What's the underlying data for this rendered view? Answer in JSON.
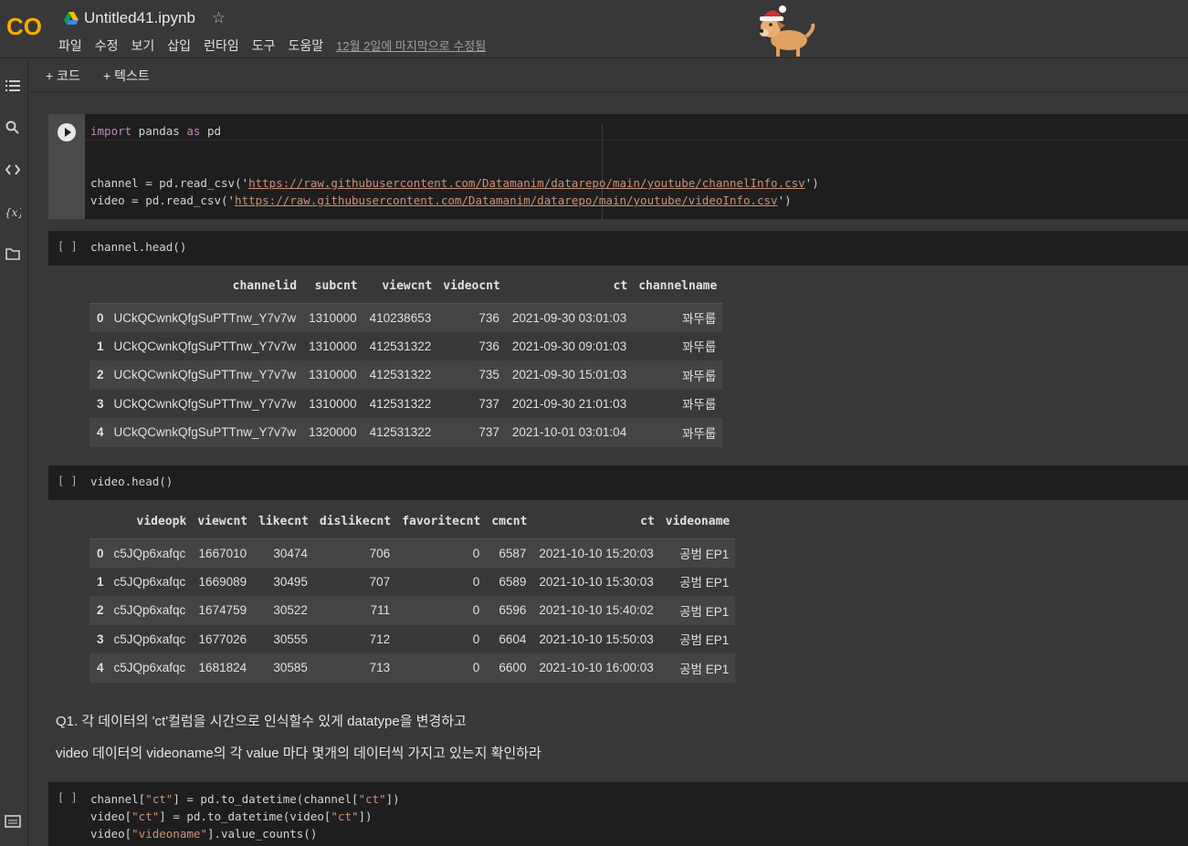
{
  "header": {
    "logo": "CO",
    "title": "Untitled41.ipynb",
    "menu": [
      "파일",
      "수정",
      "보기",
      "삽입",
      "런타임",
      "도구",
      "도움말"
    ],
    "last_edit": "12월 2일에 마지막으로 수정됨"
  },
  "toolbar": {
    "add_code": "+ 코드",
    "add_text": "+ 텍스트"
  },
  "cells": {
    "c1": {
      "line1_kw1": "import",
      "line1_mid": " pandas ",
      "line1_kw2": "as",
      "line1_end": " pd",
      "line2_pre": "channel = pd.read_csv('",
      "line2_url": "https://raw.githubusercontent.com/Datamanim/datarepo/main/youtube/channelInfo.csv",
      "line2_post": "')",
      "line3_pre": "video = pd.read_csv('",
      "line3_url": "https://raw.githubusercontent.com/Datamanim/datarepo/main/youtube/videoInfo.csv",
      "line3_post": "')"
    },
    "c2": {
      "bracket": "[ ]",
      "code": "channel.head()"
    },
    "c3": {
      "bracket": "[ ]",
      "code": "video.head()"
    },
    "c4": {
      "bracket": "[ ]",
      "l1_a": "channel[",
      "l1_s1": "\"ct\"",
      "l1_b": "] = pd.to_datetime(channel[",
      "l1_s2": "\"ct\"",
      "l1_c": "])",
      "l2_a": "video[",
      "l2_s1": "\"ct\"",
      "l2_b": "] = pd.to_datetime(video[",
      "l2_s2": "\"ct\"",
      "l2_c": "])",
      "l3_a": "video[",
      "l3_s1": "\"videoname\"",
      "l3_b": "].value_counts()"
    }
  },
  "channel_df": {
    "columns": [
      "",
      "channelid",
      "subcnt",
      "viewcnt",
      "videocnt",
      "ct",
      "channelname"
    ],
    "rows": [
      [
        "0",
        "UCkQCwnkQfgSuPTTnw_Y7v7w",
        "1310000",
        "410238653",
        "736",
        "2021-09-30 03:01:03",
        "꽈뚜룹"
      ],
      [
        "1",
        "UCkQCwnkQfgSuPTTnw_Y7v7w",
        "1310000",
        "412531322",
        "736",
        "2021-09-30 09:01:03",
        "꽈뚜룹"
      ],
      [
        "2",
        "UCkQCwnkQfgSuPTTnw_Y7v7w",
        "1310000",
        "412531322",
        "735",
        "2021-09-30 15:01:03",
        "꽈뚜룹"
      ],
      [
        "3",
        "UCkQCwnkQfgSuPTTnw_Y7v7w",
        "1310000",
        "412531322",
        "737",
        "2021-09-30 21:01:03",
        "꽈뚜룹"
      ],
      [
        "4",
        "UCkQCwnkQfgSuPTTnw_Y7v7w",
        "1320000",
        "412531322",
        "737",
        "2021-10-01 03:01:04",
        "꽈뚜룹"
      ]
    ]
  },
  "video_df": {
    "columns": [
      "",
      "videopk",
      "viewcnt",
      "likecnt",
      "dislikecnt",
      "favoritecnt",
      "cmcnt",
      "ct",
      "videoname"
    ],
    "rows": [
      [
        "0",
        "c5JQp6xafqc",
        "1667010",
        "30474",
        "706",
        "0",
        "6587",
        "2021-10-10 15:20:03",
        "공범 EP1"
      ],
      [
        "1",
        "c5JQp6xafqc",
        "1669089",
        "30495",
        "707",
        "0",
        "6589",
        "2021-10-10 15:30:03",
        "공범 EP1"
      ],
      [
        "2",
        "c5JQp6xafqc",
        "1674759",
        "30522",
        "711",
        "0",
        "6596",
        "2021-10-10 15:40:02",
        "공범 EP1"
      ],
      [
        "3",
        "c5JQp6xafqc",
        "1677026",
        "30555",
        "712",
        "0",
        "6604",
        "2021-10-10 15:50:03",
        "공범 EP1"
      ],
      [
        "4",
        "c5JQp6xafqc",
        "1681824",
        "30585",
        "713",
        "0",
        "6600",
        "2021-10-10 16:00:03",
        "공범 EP1"
      ]
    ]
  },
  "markdown": {
    "q1_line1": "Q1. 각 데이터의 'ct'컬럼을 시간으로 인식할수 있게 datatype을 변경하고",
    "q1_line2": "video 데이터의 videoname의 각 value 마다 몇개의 데이터씩 가지고 있는지 확인하라"
  },
  "colors": {
    "logo_orange": "#f9ab00",
    "background": "#383838",
    "cell_bg": "#1e1e1e"
  }
}
